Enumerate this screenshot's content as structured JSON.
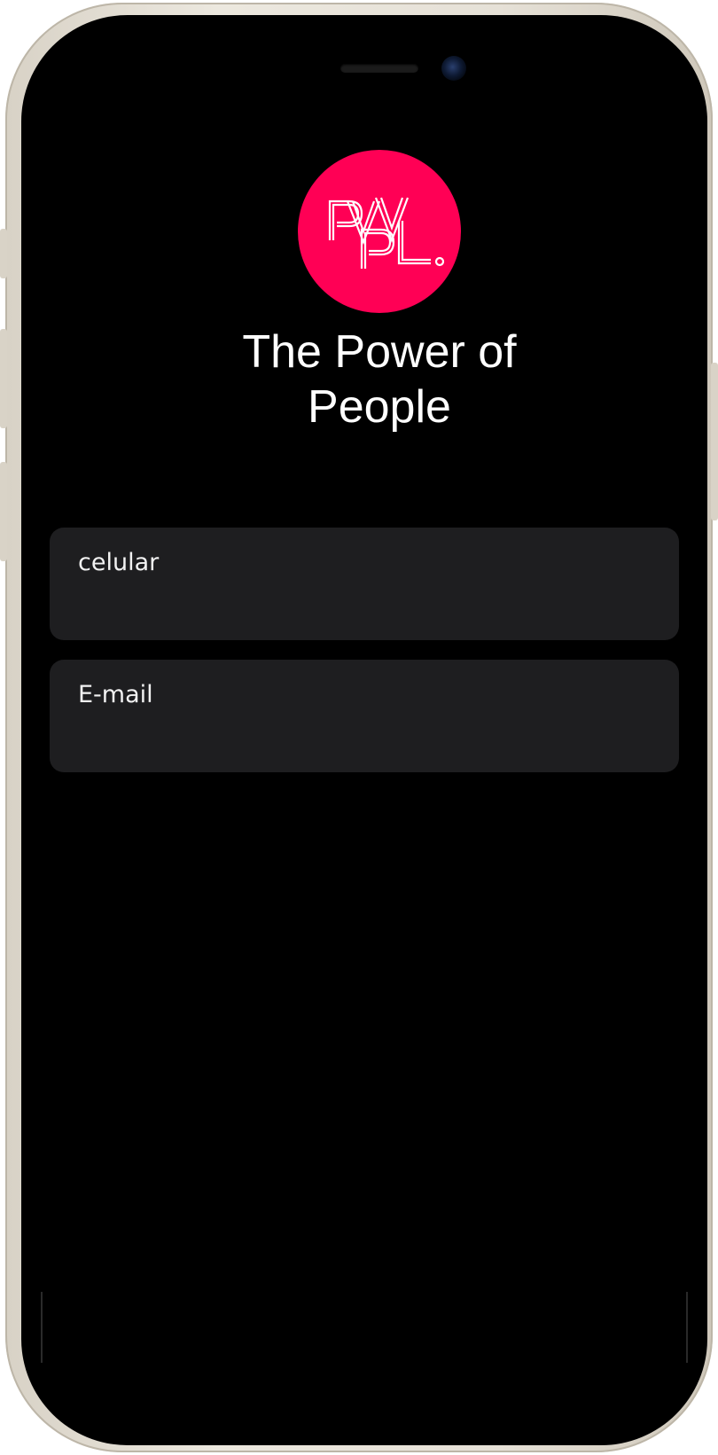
{
  "device": {
    "frame_color": "#e6e1d7",
    "screen_color": "#000000"
  },
  "app": {
    "logo_icon": "pvpl-logo-icon",
    "logo_color": "#ff0055",
    "logo_text": "PVPL.",
    "title_line1": "The Power of",
    "title_line2": "People"
  },
  "form": {
    "phone_field": {
      "label": "celular",
      "value": ""
    },
    "email_field": {
      "label": "E-mail",
      "value": ""
    },
    "field_background": "#1e1e20"
  }
}
